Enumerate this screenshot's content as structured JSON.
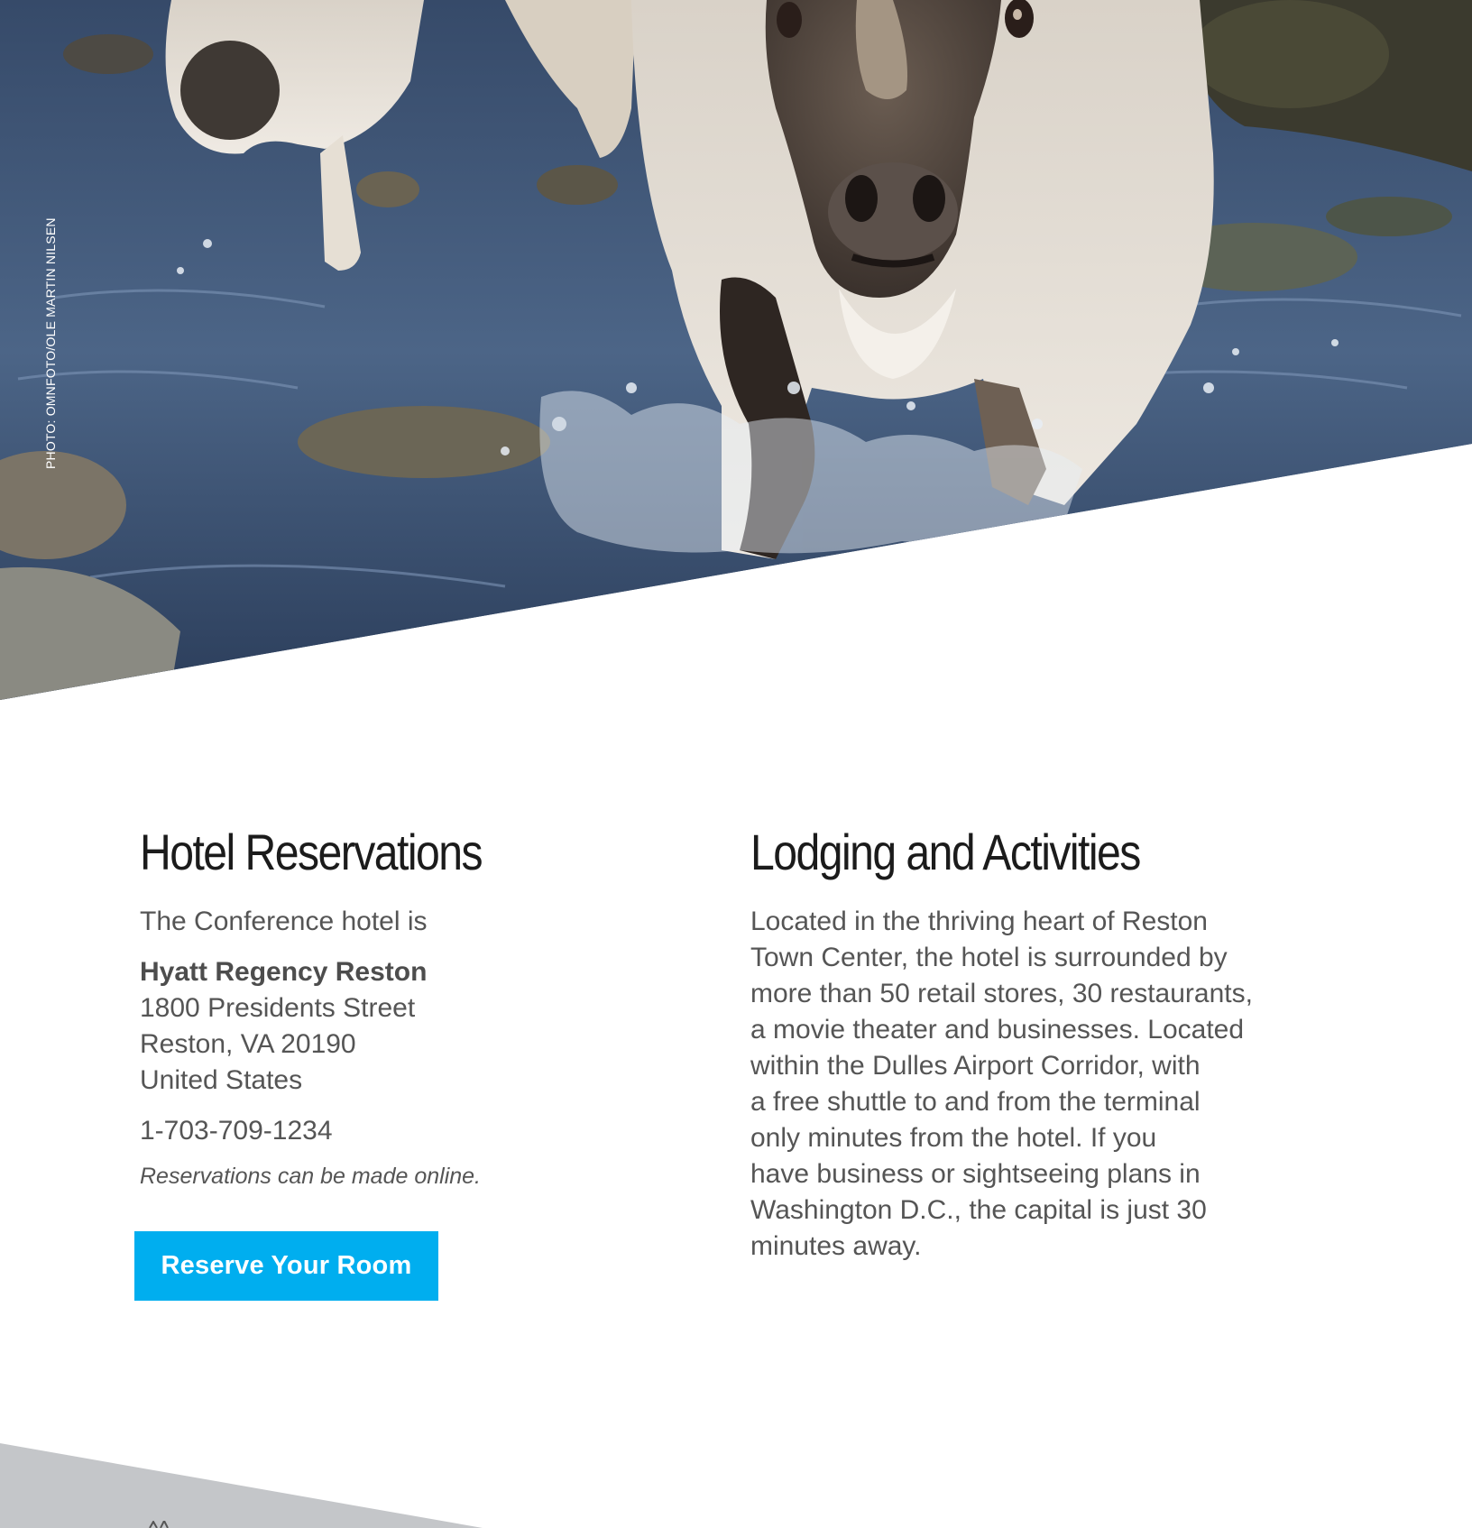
{
  "hero": {
    "photo_credit": "PHOTO: OMNFOTO/OLE MARTIN NILSEN"
  },
  "hotel": {
    "title": "Hotel Reservations",
    "intro": "The Conference hotel is",
    "name": "Hyatt Regency Reston",
    "address": [
      "1800 Presidents Street",
      "Reston, VA 20190",
      "United States"
    ],
    "phone": "1-703-709-1234",
    "note": "Reservations can be made online.",
    "button_label": "Reserve Your Room"
  },
  "lodging": {
    "title": "Lodging and Activities",
    "lines": [
      "Located in the thriving heart of Reston",
      "Town Center, the hotel is surrounded by",
      "more than 50 retail stores, 30 restaurants,",
      "a movie theater and businesses. Located",
      "within the Dulles Airport Corridor, with",
      "a free shuttle to and from the terminal",
      "only minutes from the hotel. If you",
      "have business or sightseeing plans in",
      "Washington D.C., the capital is just 30",
      "minutes away."
    ]
  },
  "colors": {
    "button": "#00aeef",
    "title": "#1b1b1b",
    "text": "#555555",
    "footer_band": "#c4c6c9"
  }
}
